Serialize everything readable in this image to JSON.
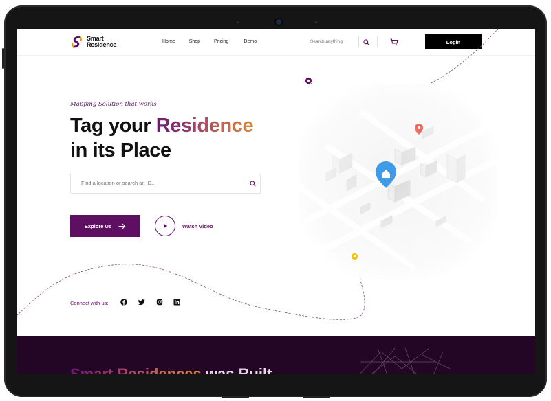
{
  "brand": {
    "name_line1": "Smart",
    "name_line2": "Residence"
  },
  "nav": {
    "links": [
      "Home",
      "Shop",
      "Pricing",
      "Demo"
    ],
    "search_placeholder": "Search anything",
    "login_label": "Login"
  },
  "hero": {
    "tagline": "Mapping Solution that works",
    "headline_part1": "Tag your ",
    "headline_highlight": "Residence",
    "headline_line2": "in its Place",
    "search_placeholder": "Find a location or search an ID...",
    "explore_label": "Explore Us",
    "watch_label": "Watch Video",
    "connect_label": "Connect with us:"
  },
  "social": [
    "facebook-icon",
    "twitter-icon",
    "instagram-icon",
    "linkedin-icon"
  ],
  "band": {
    "title_highlight": "Smart Residences",
    "title_rest": " was Built"
  },
  "colors": {
    "brand": "#5e0f61",
    "accent_orange": "#d88a3a",
    "band_bg": "#230625",
    "pin_blue": "#3d9be9",
    "pin_red": "#f26b5b",
    "pin_yellow": "#f2c200"
  }
}
